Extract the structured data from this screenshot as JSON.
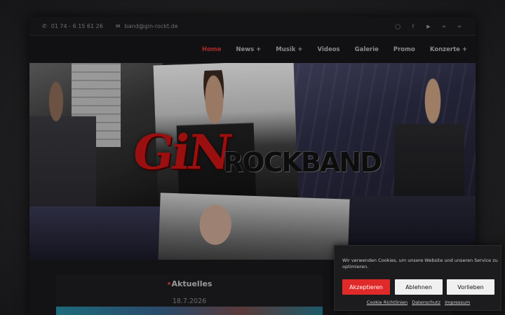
{
  "topbar": {
    "phone": "01 74 - 6 15 61 26",
    "email": "band@gin-rockt.de",
    "phone_icon": "phone-icon",
    "email_icon": "envelope-icon",
    "social_icons": [
      "instagram-icon",
      "facebook-icon",
      "youtube-icon",
      "link-icon",
      "link-icon"
    ]
  },
  "nav": {
    "items": [
      {
        "label": "Home"
      },
      {
        "label": "News +"
      },
      {
        "label": "Musik +"
      },
      {
        "label": "Videos"
      },
      {
        "label": "Galerie"
      },
      {
        "label": "Promo"
      },
      {
        "label": "Konzerte +"
      }
    ],
    "active_color": "#a82a2a"
  },
  "hero": {
    "logo_primary": "GiN",
    "logo_secondary": "ROCKBAND"
  },
  "news": {
    "title": "Aktuelles",
    "date": "18.7.2026"
  },
  "cookie": {
    "text": "Wir verwenden Cookies, um unsere Website und unseren Service zu optimieren.",
    "accept": "Akzeptieren",
    "decline": "Ablehnen",
    "preferences": "Vorlieben",
    "links": [
      "Cookie Richtlinien",
      "Datenschutz",
      "Impressum"
    ],
    "accept_color": "#e02a2a"
  }
}
